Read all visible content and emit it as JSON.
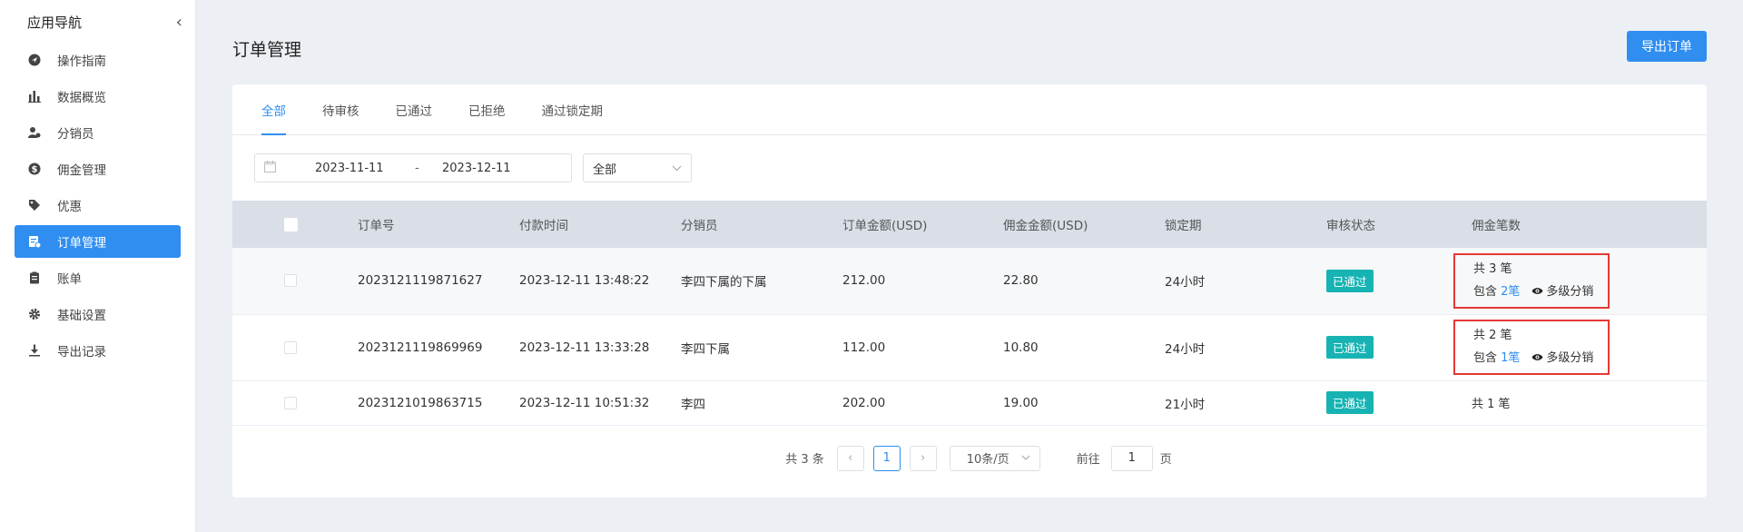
{
  "sidebar": {
    "title": "应用导航",
    "collapse_icon": "‹",
    "items": [
      {
        "label": "操作指南",
        "icon": "navigation-icon"
      },
      {
        "label": "数据概览",
        "icon": "bar-chart-icon"
      },
      {
        "label": "分销员",
        "icon": "user-group-icon"
      },
      {
        "label": "佣金管理",
        "icon": "dollar-icon"
      },
      {
        "label": "优惠",
        "icon": "tag-icon"
      },
      {
        "label": "订单管理",
        "icon": "order-icon"
      },
      {
        "label": "账单",
        "icon": "clipboard-icon"
      },
      {
        "label": "基础设置",
        "icon": "gear-icon"
      },
      {
        "label": "导出记录",
        "icon": "download-icon"
      }
    ],
    "active_index": 5
  },
  "header": {
    "title": "订单管理",
    "export_label": "导出订单"
  },
  "tabs": [
    "全部",
    "待审核",
    "已通过",
    "已拒绝",
    "通过锁定期"
  ],
  "active_tab": 0,
  "filters": {
    "date_start": "2023-11-11",
    "date_sep": "-",
    "date_end": "2023-12-11",
    "status_select": "全部"
  },
  "table": {
    "columns": [
      "订单号",
      "付款时间",
      "分销员",
      "订单金额(USD)",
      "佣金金额(USD)",
      "锁定期",
      "审核状态",
      "佣金笔数"
    ],
    "rows": [
      {
        "order_no": "2023121119871627",
        "paid_at": "2023-12-11 13:48:22",
        "distributor": "李四下属的下属",
        "order_amount": "212.00",
        "commission": "22.80",
        "lock_period": "24小时",
        "status": "已通过",
        "count_total": "共 3 笔",
        "contains_prefix": "包含",
        "contains_link": "2笔",
        "multi_level": "多级分销"
      },
      {
        "order_no": "2023121119869969",
        "paid_at": "2023-12-11 13:33:28",
        "distributor": "李四下属",
        "order_amount": "112.00",
        "commission": "10.80",
        "lock_period": "24小时",
        "status": "已通过",
        "count_total": "共 2 笔",
        "contains_prefix": "包含",
        "contains_link": "1笔",
        "multi_level": "多级分销"
      },
      {
        "order_no": "2023121019863715",
        "paid_at": "2023-12-11 10:51:32",
        "distributor": "李四",
        "order_amount": "202.00",
        "commission": "19.00",
        "lock_period": "21小时",
        "status": "已通过",
        "count_total": "共 1 笔"
      }
    ]
  },
  "pagination": {
    "total": "共 3 条",
    "prev": "‹",
    "current_page": "1",
    "next": "›",
    "page_size": "10条/页",
    "goto_label": "前往",
    "goto_value": "1",
    "page_unit": "页"
  },
  "colors": {
    "accent": "#2f8ef0",
    "status_pass": "#17b3b3",
    "highlight_border": "#e53935"
  }
}
